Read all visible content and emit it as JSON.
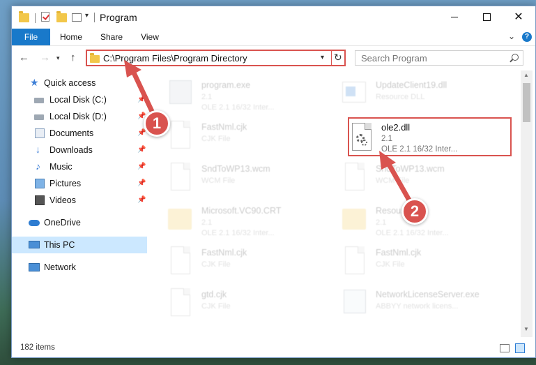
{
  "window": {
    "title": "Program",
    "controls": {
      "minimize": "",
      "maximize": "",
      "close": "✕"
    }
  },
  "ribbon": {
    "tabs": [
      "File",
      "Home",
      "Share",
      "View"
    ]
  },
  "address_bar": {
    "path": "C:\\Program Files\\Program Directory",
    "search_placeholder": "Search Program"
  },
  "sidebar": {
    "items": [
      {
        "label": "Quick access",
        "icon": "star-icon"
      },
      {
        "label": "Local Disk (C:)",
        "icon": "disk-icon",
        "pinned": true
      },
      {
        "label": "Local Disk (D:)",
        "icon": "disk-icon",
        "pinned": true
      },
      {
        "label": "Documents",
        "icon": "documents-icon",
        "pinned": true
      },
      {
        "label": "Downloads",
        "icon": "downloads-icon",
        "pinned": true
      },
      {
        "label": "Music",
        "icon": "music-icon",
        "pinned": true
      },
      {
        "label": "Pictures",
        "icon": "pictures-icon",
        "pinned": true
      },
      {
        "label": "Videos",
        "icon": "videos-icon",
        "pinned": true
      },
      {
        "label": "OneDrive",
        "icon": "onedrive-icon"
      },
      {
        "label": "This PC",
        "icon": "this-pc-icon",
        "selected": true
      },
      {
        "label": "Network",
        "icon": "network-icon"
      }
    ]
  },
  "files": [
    {
      "name": "program.exe",
      "line1": "2.1",
      "line2": "OLE 2.1 16/32 Inter...",
      "icon": "exe-icon"
    },
    {
      "name": "UpdateClient19.dll",
      "line1": "Resource DLL",
      "line2": "",
      "icon": "dll-icon"
    },
    {
      "name": "FastNml.cjk",
      "line1": "CJK File",
      "line2": "",
      "icon": "file-icon"
    },
    {
      "name": "ole2.dll",
      "line1": "2.1",
      "line2": "OLE 2.1 16/32 Inter...",
      "icon": "dll-gear-icon",
      "highlighted": true
    },
    {
      "name": "SndToWP13.wcm",
      "line1": "WCM File",
      "line2": "",
      "icon": "file-icon"
    },
    {
      "name": "SndToWP13.wcm",
      "line1": "WCM File",
      "line2": "",
      "icon": "file-icon"
    },
    {
      "name": "Microsoft.VC90.CRT",
      "line1": "2.1",
      "line2": "OLE 2.1 16/32 Inter...",
      "icon": "folder-icon"
    },
    {
      "name": "Resources",
      "line1": "2.1",
      "line2": "OLE 2.1 16/32 Inter...",
      "icon": "folder-icon"
    },
    {
      "name": "FastNml.cjk",
      "line1": "CJK File",
      "line2": "",
      "icon": "file-icon"
    },
    {
      "name": "FastNml.cjk",
      "line1": "CJK File",
      "line2": "",
      "icon": "file-icon"
    },
    {
      "name": "gtd.cjk",
      "line1": "CJK File",
      "line2": "",
      "icon": "file-icon"
    },
    {
      "name": "NetworkLicenseServer.exe",
      "line1": "ABBYY network licens...",
      "line2": "",
      "icon": "app-icon"
    }
  ],
  "status": {
    "item_count": "182 items"
  },
  "annotations": {
    "badge1": "1",
    "badge2": "2",
    "accent_color": "#d9534f"
  }
}
